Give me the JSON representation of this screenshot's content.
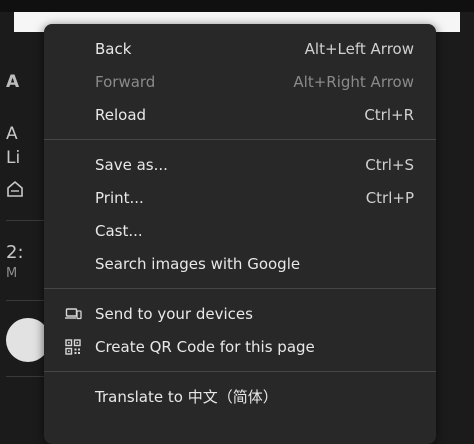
{
  "background": {
    "heading_fragment": "A",
    "line1_fragment": "A",
    "line2_fragment": "Li",
    "number_fragment": "2:",
    "sub_fragment": "M"
  },
  "menu": {
    "group1": [
      {
        "label": "Back",
        "shortcut": "Alt+Left Arrow",
        "enabled": true
      },
      {
        "label": "Forward",
        "shortcut": "Alt+Right Arrow",
        "enabled": false
      },
      {
        "label": "Reload",
        "shortcut": "Ctrl+R",
        "enabled": true
      }
    ],
    "group2": [
      {
        "label": "Save as...",
        "shortcut": "Ctrl+S",
        "enabled": true
      },
      {
        "label": "Print...",
        "shortcut": "Ctrl+P",
        "enabled": true
      },
      {
        "label": "Cast...",
        "shortcut": "",
        "enabled": true
      },
      {
        "label": "Search images with Google",
        "shortcut": "",
        "enabled": true
      }
    ],
    "group3": [
      {
        "label": "Send to your devices",
        "icon": "laptop-phone-icon"
      },
      {
        "label": "Create QR Code for this page",
        "icon": "qr-code-icon"
      }
    ],
    "group4": [
      {
        "label": "Translate to 中文（简体）"
      }
    ]
  }
}
